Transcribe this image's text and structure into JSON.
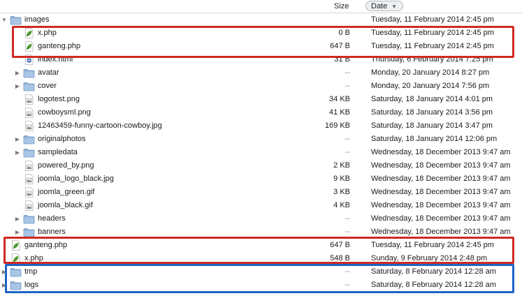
{
  "header": {
    "size_label": "Size",
    "date_label": "Date",
    "sort_indicator": "▼"
  },
  "rows": [
    {
      "name": "images",
      "size": "",
      "date": "Tuesday, 11 February 2014 2:45 pm",
      "icon": "folder-icon",
      "level": 0,
      "disclosure": "open"
    },
    {
      "name": "x.php",
      "size": "0 B",
      "date": "Tuesday, 11 February 2014 2:45 pm",
      "icon": "php-leaf-icon",
      "level": 1,
      "disclosure": ""
    },
    {
      "name": "ganteng.php",
      "size": "647 B",
      "date": "Tuesday, 11 February 2014 2:45 pm",
      "icon": "php-leaf-icon",
      "level": 1,
      "disclosure": ""
    },
    {
      "name": "index.html",
      "size": "31 B",
      "date": "Thursday, 6 February 2014 7:25 pm",
      "icon": "html-file-icon",
      "level": 1,
      "disclosure": ""
    },
    {
      "name": "avatar",
      "size": "--",
      "date": "Monday, 20 January 2014 8:27 pm",
      "icon": "folder-icon",
      "level": 1,
      "disclosure": "closed"
    },
    {
      "name": "cover",
      "size": "--",
      "date": "Monday, 20 January 2014 7:56 pm",
      "icon": "folder-icon",
      "level": 1,
      "disclosure": "closed"
    },
    {
      "name": "logotest.png",
      "size": "34 KB",
      "date": "Saturday, 18 January 2014 4:01 pm",
      "icon": "image-file-icon",
      "level": 1,
      "disclosure": ""
    },
    {
      "name": "cowboysml.png",
      "size": "41 KB",
      "date": "Saturday, 18 January 2014 3:56 pm",
      "icon": "image-file-icon",
      "level": 1,
      "disclosure": ""
    },
    {
      "name": "12463459-funny-cartoon-cowboy.jpg",
      "size": "169 KB",
      "date": "Saturday, 18 January 2014 3:47 pm",
      "icon": "image-file-icon",
      "level": 1,
      "disclosure": ""
    },
    {
      "name": "originalphotos",
      "size": "--",
      "date": "Saturday, 18 January 2014 12:06 pm",
      "icon": "folder-icon",
      "level": 1,
      "disclosure": "closed"
    },
    {
      "name": "sampledata",
      "size": "--",
      "date": "Wednesday, 18 December 2013 9:47 am",
      "icon": "folder-icon",
      "level": 1,
      "disclosure": "closed"
    },
    {
      "name": "powered_by.png",
      "size": "2 KB",
      "date": "Wednesday, 18 December 2013 9:47 am",
      "icon": "image-file-icon",
      "level": 1,
      "disclosure": ""
    },
    {
      "name": "joomla_logo_black.jpg",
      "size": "9 KB",
      "date": "Wednesday, 18 December 2013 9:47 am",
      "icon": "image-file-icon",
      "level": 1,
      "disclosure": ""
    },
    {
      "name": "joomla_green.gif",
      "size": "3 KB",
      "date": "Wednesday, 18 December 2013 9:47 am",
      "icon": "image-file-icon",
      "level": 1,
      "disclosure": ""
    },
    {
      "name": "joomla_black.gif",
      "size": "4 KB",
      "date": "Wednesday, 18 December 2013 9:47 am",
      "icon": "image-file-icon",
      "level": 1,
      "disclosure": ""
    },
    {
      "name": "headers",
      "size": "--",
      "date": "Wednesday, 18 December 2013 9:47 am",
      "icon": "folder-icon",
      "level": 1,
      "disclosure": "closed"
    },
    {
      "name": "banners",
      "size": "--",
      "date": "Wednesday, 18 December 2013 9:47 am",
      "icon": "folder-icon",
      "level": 1,
      "disclosure": "closed"
    },
    {
      "name": "ganteng.php",
      "size": "647 B",
      "date": "Tuesday, 11 February 2014 2:45 pm",
      "icon": "php-leaf-icon",
      "level": 0,
      "disclosure": ""
    },
    {
      "name": "x.php",
      "size": "548 B",
      "date": "Sunday, 9 February 2014 2:48 pm",
      "icon": "php-leaf-icon",
      "level": 0,
      "disclosure": ""
    },
    {
      "name": "tmp",
      "size": "--",
      "date": "Saturday, 8 February 2014 12:28 am",
      "icon": "folder-icon",
      "level": 0,
      "disclosure": "closed"
    },
    {
      "name": "logs",
      "size": "--",
      "date": "Saturday, 8 February 2014 12:28 am",
      "icon": "folder-icon",
      "level": 0,
      "disclosure": "closed"
    }
  ],
  "highlights": [
    {
      "color": "#d02a22",
      "label": "images-php-highlight"
    },
    {
      "color": "#d02a22",
      "label": "root-php-highlight"
    },
    {
      "color": "#1d63c8",
      "label": "tmp-logs-highlight"
    }
  ],
  "colors": {
    "folder": "#8fb1d6",
    "folder_dark": "#6e95c2",
    "leaf": "#5aa83a",
    "red_box": "#d02a22",
    "blue_box": "#1d63c8"
  }
}
